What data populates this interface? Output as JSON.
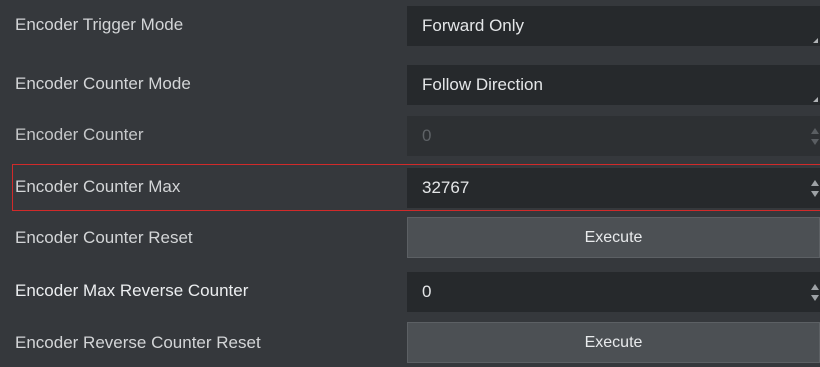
{
  "properties": [
    {
      "label": "Encoder Trigger Mode",
      "type": "combo",
      "value": "Forward Only"
    },
    {
      "label": "Encoder Counter Mode",
      "type": "combo",
      "value": "Follow Direction"
    },
    {
      "label": "Encoder Counter",
      "type": "spin",
      "value": "0",
      "disabled": true
    },
    {
      "label": "Encoder Counter Max",
      "type": "spin",
      "value": "32767",
      "selected": true
    },
    {
      "label": "Encoder Counter Reset",
      "type": "button",
      "button_label": "Execute"
    },
    {
      "label": "Encoder Max Reverse Counter",
      "type": "spin",
      "value": "0"
    },
    {
      "label": "Encoder Reverse Counter Reset",
      "type": "button",
      "button_label": "Execute"
    }
  ],
  "colors": {
    "background": "#35383c",
    "field": "#26292c",
    "button": "#4c5054",
    "selection_border": "#d12a2a"
  }
}
